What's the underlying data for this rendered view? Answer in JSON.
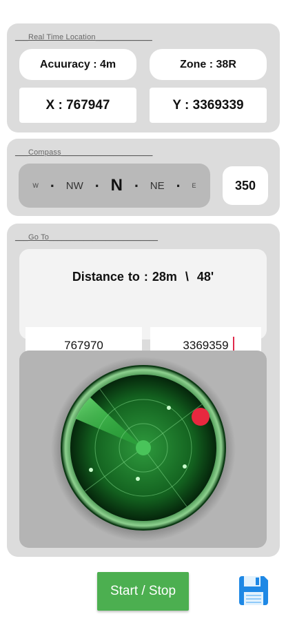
{
  "real_time_location": {
    "title": "Real Time Location",
    "accuracy": "Acuuracy : 4m",
    "zone": "Zone : 38R",
    "x": "X : 767947",
    "y": "Y : 3369339"
  },
  "compass": {
    "title": "Compass",
    "strip": [
      "W",
      ".",
      "NW",
      ".",
      "N",
      ".",
      "NE",
      ".",
      "E"
    ],
    "heading": "350"
  },
  "go_to": {
    "title": "Go To",
    "distance_label": "Distance to : 28m  \\  48'",
    "target_x": "767970",
    "target_y": "3369359"
  },
  "controls": {
    "start_stop_label": "Start / Stop",
    "save_icon": "save-icon"
  },
  "colors": {
    "accent_green": "#4caf50",
    "target_red": "#e8283f",
    "radar_green": "#1d7a2b"
  }
}
